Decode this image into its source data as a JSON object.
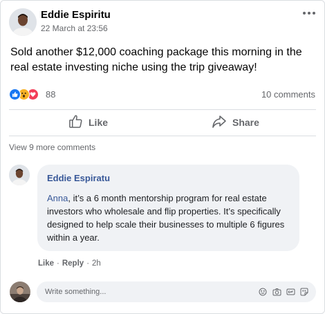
{
  "post": {
    "author": "Eddie Espiritu",
    "timestamp": "22 March at 23:56",
    "text": "Sold another $12,000 coaching package this morning in the real estate investing niche using the trip giveaway!",
    "reaction_count": "88",
    "comment_count": "10 comments",
    "reaction_types": [
      "like",
      "wow",
      "love"
    ]
  },
  "actions": {
    "like_label": "Like",
    "share_label": "Share"
  },
  "comments": {
    "view_more": "View 9 more comments",
    "items": [
      {
        "author": "Eddie Espiratu",
        "mention": "Anna",
        "text": ", it’s a 6 month mentorship program for real estate investors who wholesale and flip properties. It’s specifically designed to help scale their businesses to multiple 6 figures within a year.",
        "like_label": "Like",
        "reply_label": "Reply",
        "separator": "·",
        "time": "2h"
      }
    ]
  },
  "composer": {
    "placeholder": "Write something...",
    "icons": [
      "emoji-icon",
      "camera-icon",
      "gif-icon",
      "sticker-icon"
    ]
  },
  "colors": {
    "link_blue": "#385898",
    "like_blue": "#1877f2",
    "wow_yellow": "#f7b125",
    "love_red": "#f33e58",
    "secondary_text": "#65676b",
    "bubble_bg": "#f0f2f5"
  }
}
